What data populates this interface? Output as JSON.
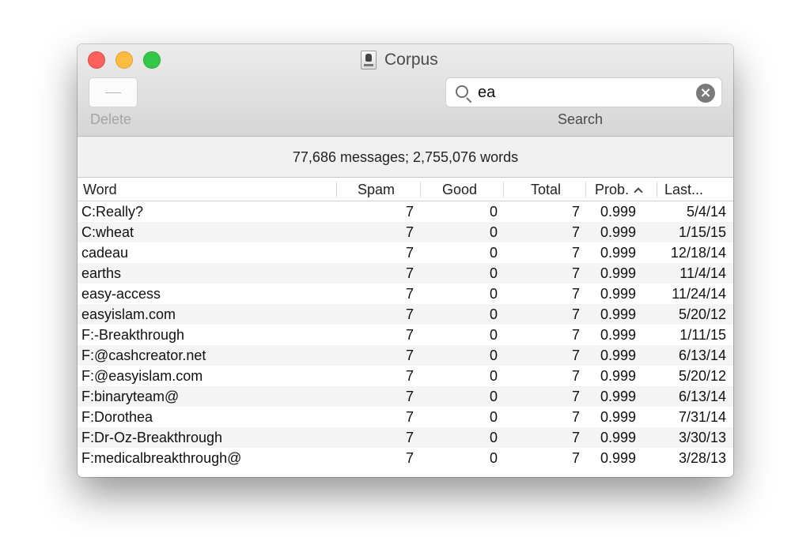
{
  "window": {
    "title": "Corpus"
  },
  "toolbar": {
    "delete_label": "Delete",
    "search_label": "Search",
    "search_value": "ea"
  },
  "summary": "77,686 messages; 2,755,076 words",
  "columns": [
    "Word",
    "Spam",
    "Good",
    "Total",
    "Prob.",
    "Last..."
  ],
  "sort": {
    "column": "Prob.",
    "direction": "ascending"
  },
  "rows": [
    {
      "word": "C:Really?",
      "spam": "7",
      "good": "0",
      "total": "7",
      "prob": "0.999",
      "last": "5/4/14"
    },
    {
      "word": "C:wheat",
      "spam": "7",
      "good": "0",
      "total": "7",
      "prob": "0.999",
      "last": "1/15/15"
    },
    {
      "word": "cadeau",
      "spam": "7",
      "good": "0",
      "total": "7",
      "prob": "0.999",
      "last": "12/18/14"
    },
    {
      "word": "earths",
      "spam": "7",
      "good": "0",
      "total": "7",
      "prob": "0.999",
      "last": "11/4/14"
    },
    {
      "word": "easy-access",
      "spam": "7",
      "good": "0",
      "total": "7",
      "prob": "0.999",
      "last": "11/24/14"
    },
    {
      "word": "easyislam.com",
      "spam": "7",
      "good": "0",
      "total": "7",
      "prob": "0.999",
      "last": "5/20/12"
    },
    {
      "word": "F:-Breakthrough",
      "spam": "7",
      "good": "0",
      "total": "7",
      "prob": "0.999",
      "last": "1/11/15"
    },
    {
      "word": "F:@cashcreator.net",
      "spam": "7",
      "good": "0",
      "total": "7",
      "prob": "0.999",
      "last": "6/13/14"
    },
    {
      "word": "F:@easyislam.com",
      "spam": "7",
      "good": "0",
      "total": "7",
      "prob": "0.999",
      "last": "5/20/12"
    },
    {
      "word": "F:binaryteam@",
      "spam": "7",
      "good": "0",
      "total": "7",
      "prob": "0.999",
      "last": "6/13/14"
    },
    {
      "word": "F:Dorothea",
      "spam": "7",
      "good": "0",
      "total": "7",
      "prob": "0.999",
      "last": "7/31/14"
    },
    {
      "word": "F:Dr-Oz-Breakthrough",
      "spam": "7",
      "good": "0",
      "total": "7",
      "prob": "0.999",
      "last": "3/30/13"
    },
    {
      "word": "F:medicalbreakthrough@",
      "spam": "7",
      "good": "0",
      "total": "7",
      "prob": "0.999",
      "last": "3/28/13"
    }
  ]
}
